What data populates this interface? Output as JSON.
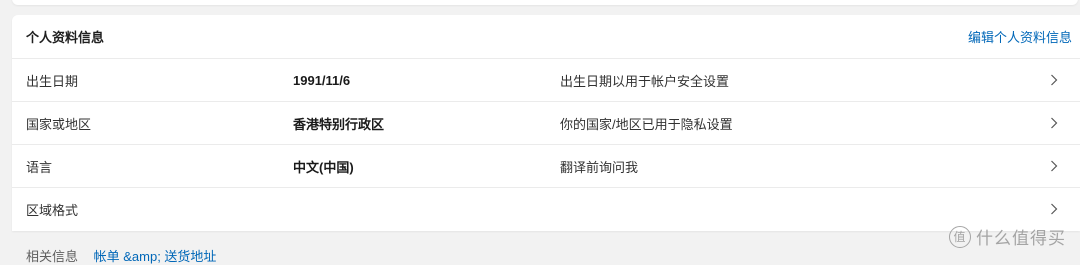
{
  "section": {
    "title": "个人资料信息",
    "edit_link": "编辑个人资料信息"
  },
  "rows": [
    {
      "label": "出生日期",
      "value": "1991/11/6",
      "description": "出生日期以用于帐户安全设置",
      "icon": "chevron-right-icon"
    },
    {
      "label": "国家或地区",
      "value": "香港特别行政区",
      "description": "你的国家/地区已用于隐私设置",
      "icon": "chevron-right-icon"
    },
    {
      "label": "语言",
      "value": "中文(中国)",
      "description": "翻译前询问我",
      "icon": "chevron-right-icon"
    },
    {
      "label": "区域格式",
      "value": "",
      "description": "",
      "icon": "chevron-right-icon"
    }
  ],
  "related": {
    "label": "相关信息",
    "link": "帐单 &amp; 送货地址"
  },
  "watermark": {
    "logo_glyph": "值",
    "text": "什么值得买"
  },
  "colors": {
    "link": "#0067b8",
    "background": "#f2f2f2",
    "card": "#ffffff",
    "divider": "#ebebeb"
  }
}
